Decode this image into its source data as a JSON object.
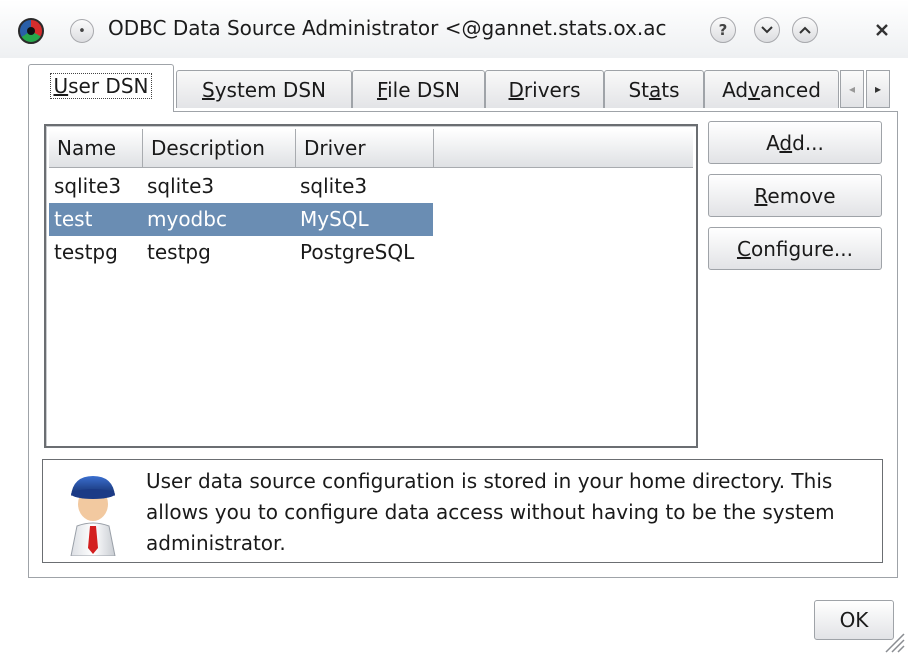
{
  "window": {
    "title": "ODBC Data Source Administrator <@gannet.stats.ox.ac",
    "app_icon": "odbc-app-icon",
    "controls": {
      "sticky_icon": "dot-icon",
      "help_label": "?",
      "minimize_icon": "chevron-down-icon",
      "maximize_icon": "chevron-up-icon",
      "close_icon": "close-icon"
    }
  },
  "tabs": [
    {
      "pre": "",
      "key": "U",
      "post": "ser DSN",
      "active": true
    },
    {
      "pre": "",
      "key": "S",
      "post": "ystem DSN",
      "active": false
    },
    {
      "pre": "",
      "key": "F",
      "post": "ile DSN",
      "active": false
    },
    {
      "pre": "",
      "key": "D",
      "post": "rivers",
      "active": false
    },
    {
      "pre": "St",
      "key": "a",
      "post": "ts",
      "active": false
    },
    {
      "pre": "Ad",
      "key": "v",
      "post": "anced",
      "active": false
    }
  ],
  "tab_scroll": {
    "left_icon": "arrow-left-icon",
    "right_icon": "arrow-right-icon"
  },
  "list": {
    "columns": [
      "Name",
      "Description",
      "Driver"
    ],
    "rows": [
      {
        "name": "sqlite3",
        "description": "sqlite3",
        "driver": "sqlite3",
        "selected": false
      },
      {
        "name": "test",
        "description": "myodbc",
        "driver": "MySQL",
        "selected": true
      },
      {
        "name": "testpg",
        "description": "testpg",
        "driver": "PostgreSQL",
        "selected": false
      }
    ],
    "selection_color": "#6a8db3"
  },
  "buttons": {
    "add": {
      "pre": "A",
      "key": "d",
      "post": "d..."
    },
    "remove": {
      "pre": "",
      "key": "R",
      "post": "emove"
    },
    "configure": {
      "pre": "",
      "key": "C",
      "post": "onfigure..."
    },
    "ok": "OK"
  },
  "info": {
    "icon": "user-avatar-icon",
    "text": "User data source configuration is stored in your home directory. This allows you to configure data access without having to be the system administrator."
  }
}
